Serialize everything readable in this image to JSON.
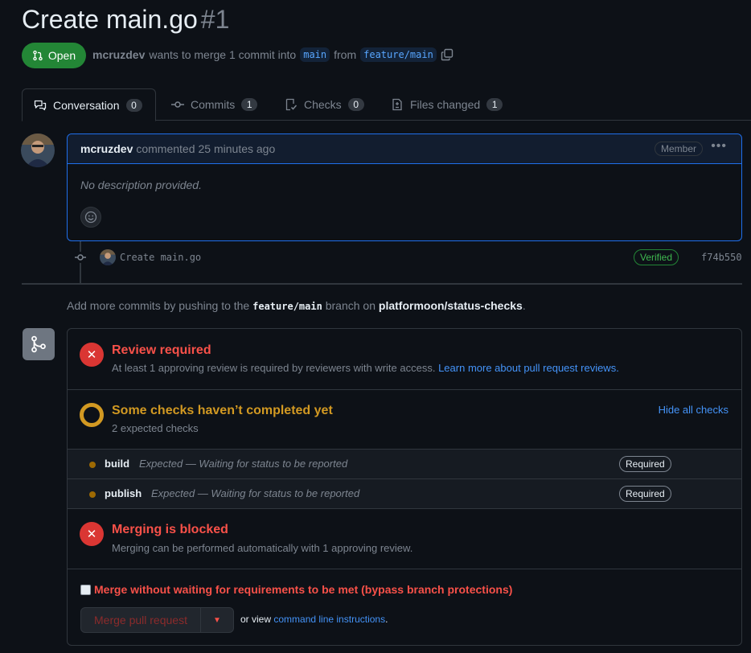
{
  "header": {
    "title": "Create main.go",
    "number": "#1",
    "state": "Open",
    "author": "mcruzdev",
    "merge_text": "wants to merge 1 commit into",
    "base_branch": "main",
    "from_text": "from",
    "head_branch": "feature/main"
  },
  "tabs": [
    {
      "label": "Conversation",
      "count": "0"
    },
    {
      "label": "Commits",
      "count": "1"
    },
    {
      "label": "Checks",
      "count": "0"
    },
    {
      "label": "Files changed",
      "count": "1"
    }
  ],
  "comment": {
    "author": "mcruzdev",
    "action": "commented",
    "time": "25 minutes ago",
    "badge": "Member",
    "body": "No description provided."
  },
  "commit": {
    "message": "Create main.go",
    "verified": "Verified",
    "sha": "f74b550"
  },
  "push_hint": {
    "prefix": "Add more commits by pushing to the",
    "branch": "feature/main",
    "middle": "branch on",
    "repo": "platformoon/status-checks",
    "suffix": "."
  },
  "merge": {
    "review": {
      "title": "Review required",
      "desc": "At least 1 approving review is required by reviewers with write access.",
      "link": "Learn more about pull request reviews."
    },
    "checks": {
      "title": "Some checks haven’t completed yet",
      "desc": "2 expected checks",
      "hide_link": "Hide all checks",
      "items": [
        {
          "name": "build",
          "desc": "Expected — Waiting for status to be reported",
          "badge": "Required"
        },
        {
          "name": "publish",
          "desc": "Expected — Waiting for status to be reported",
          "badge": "Required"
        }
      ]
    },
    "blocked": {
      "title": "Merging is blocked",
      "desc": "Merging can be performed automatically with 1 approving review."
    },
    "bypass_label": "Merge without waiting for requirements to be met (bypass branch protections)",
    "merge_button": "Merge pull request",
    "cli_prefix": "or view",
    "cli_link": "command line instructions",
    "cli_suffix": "."
  },
  "colors": {
    "open_green": "#238636",
    "fail_red": "#da3633",
    "pending_yellow": "#d29922",
    "link_blue": "#4493f8"
  }
}
